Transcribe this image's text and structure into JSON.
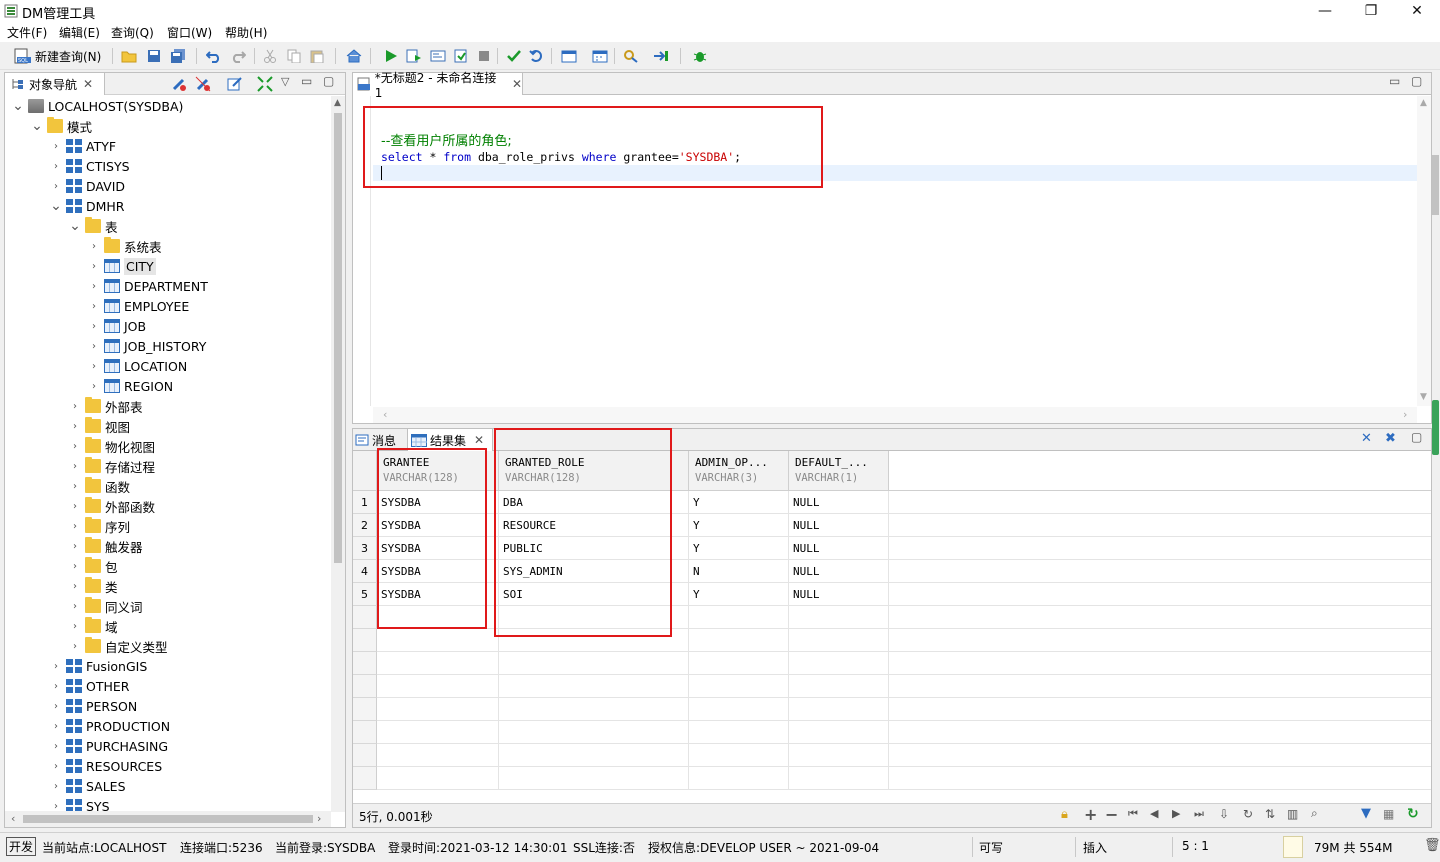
{
  "window": {
    "title": "DM管理工具",
    "minimize": "—",
    "maximize": "❐",
    "close": "✕"
  },
  "menu": [
    "文件(F)",
    "编辑(E)",
    "查询(Q)",
    "窗口(W)",
    "帮助(H)"
  ],
  "toolbar": {
    "new_query": "新建查询(N)"
  },
  "nav": {
    "tab_label": "对象导航",
    "tree": [
      {
        "label": "LOCALHOST(SYSDBA)",
        "icon": "server",
        "level": 0,
        "expanded": true
      },
      {
        "label": "模式",
        "icon": "folder",
        "level": 1,
        "expanded": true
      },
      {
        "label": "ATYF",
        "icon": "schema",
        "level": 2
      },
      {
        "label": "CTISYS",
        "icon": "schema",
        "level": 2
      },
      {
        "label": "DAVID",
        "icon": "schema",
        "level": 2
      },
      {
        "label": "DMHR",
        "icon": "schema",
        "level": 2,
        "expanded": true
      },
      {
        "label": "表",
        "icon": "folder",
        "level": 3,
        "expanded": true
      },
      {
        "label": "系统表",
        "icon": "folder",
        "level": 4
      },
      {
        "label": "CITY",
        "icon": "table",
        "level": 4,
        "selected": true
      },
      {
        "label": "DEPARTMENT",
        "icon": "table",
        "level": 4
      },
      {
        "label": "EMPLOYEE",
        "icon": "table",
        "level": 4
      },
      {
        "label": "JOB",
        "icon": "table",
        "level": 4
      },
      {
        "label": "JOB_HISTORY",
        "icon": "table",
        "level": 4
      },
      {
        "label": "LOCATION",
        "icon": "table",
        "level": 4
      },
      {
        "label": "REGION",
        "icon": "table",
        "level": 4
      },
      {
        "label": "外部表",
        "icon": "folder",
        "level": 3
      },
      {
        "label": "视图",
        "icon": "folder",
        "level": 3
      },
      {
        "label": "物化视图",
        "icon": "folder",
        "level": 3
      },
      {
        "label": "存储过程",
        "icon": "folder",
        "level": 3
      },
      {
        "label": "函数",
        "icon": "folder",
        "level": 3
      },
      {
        "label": "外部函数",
        "icon": "folder",
        "level": 3
      },
      {
        "label": "序列",
        "icon": "folder",
        "level": 3
      },
      {
        "label": "触发器",
        "icon": "folder",
        "level": 3
      },
      {
        "label": "包",
        "icon": "folder",
        "level": 3
      },
      {
        "label": "类",
        "icon": "folder",
        "level": 3
      },
      {
        "label": "同义词",
        "icon": "folder",
        "level": 3
      },
      {
        "label": "域",
        "icon": "folder",
        "level": 3
      },
      {
        "label": "自定义类型",
        "icon": "folder",
        "level": 3
      },
      {
        "label": "FusionGIS",
        "icon": "schema",
        "level": 2
      },
      {
        "label": "OTHER",
        "icon": "schema",
        "level": 2
      },
      {
        "label": "PERSON",
        "icon": "schema",
        "level": 2
      },
      {
        "label": "PRODUCTION",
        "icon": "schema",
        "level": 2
      },
      {
        "label": "PURCHASING",
        "icon": "schema",
        "level": 2
      },
      {
        "label": "RESOURCES",
        "icon": "schema",
        "level": 2
      },
      {
        "label": "SALES",
        "icon": "schema",
        "level": 2
      },
      {
        "label": "SYS",
        "icon": "schema",
        "level": 2
      }
    ]
  },
  "editor": {
    "tab_label": "*无标题2 - 未命名连接1",
    "comment": "--查看用户所属的角色;",
    "sql": {
      "kw1": "select",
      "star": " * ",
      "kw2": "from",
      "obj": " dba_role_privs ",
      "kw3": "where",
      "cond": " grantee=",
      "str": "'SYSDBA'",
      "end": ";"
    }
  },
  "results": {
    "tab_messages": "消息",
    "tab_resultset": "结果集",
    "columns": [
      {
        "name": "GRANTEE",
        "type": "VARCHAR(128)"
      },
      {
        "name": "GRANTED_ROLE",
        "type": "VARCHAR(128)"
      },
      {
        "name": "ADMIN_OP...",
        "type": "VARCHAR(3)"
      },
      {
        "name": "DEFAULT_...",
        "type": "VARCHAR(1)"
      }
    ],
    "rows": [
      [
        "1",
        "SYSDBA",
        "DBA",
        "Y",
        "NULL"
      ],
      [
        "2",
        "SYSDBA",
        "RESOURCE",
        "Y",
        "NULL"
      ],
      [
        "3",
        "SYSDBA",
        "PUBLIC",
        "Y",
        "NULL"
      ],
      [
        "4",
        "SYSDBA",
        "SYS_ADMIN",
        "N",
        "NULL"
      ],
      [
        "5",
        "SYSDBA",
        "SOI",
        "Y",
        "NULL"
      ]
    ],
    "summary": "5行, 0.001秒"
  },
  "status": {
    "mode": "开发",
    "site": "当前站点:LOCALHOST",
    "port": "连接端口:5236",
    "login": "当前登录:SYSDBA",
    "login_time": "登录时间:2021-03-12 14:30:01",
    "ssl": "SSL连接:否",
    "license": "授权信息:DEVELOP USER ~ 2021-09-04",
    "writable": "可写",
    "insert": "插入",
    "position": "5 : 1",
    "memory": "79M 共 554M"
  },
  "colors": {
    "keyword": "#0000c8",
    "comment": "#008000",
    "string": "#c80000",
    "highlight_box": "#e0191a",
    "accent": "#2f6fbd"
  }
}
